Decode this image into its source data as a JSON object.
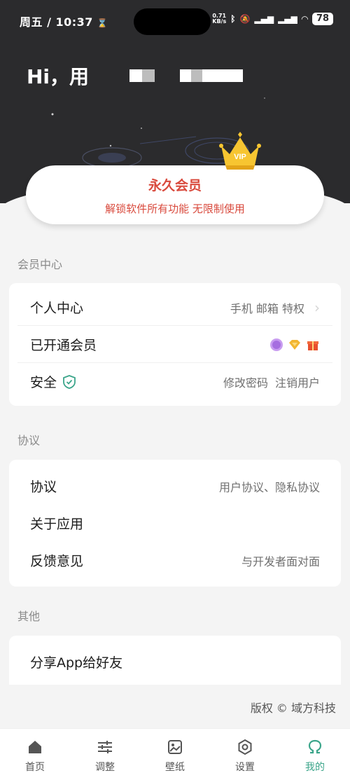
{
  "status_bar": {
    "time": "周五 / 10:37",
    "net_speed_value": "0.71",
    "net_speed_unit": "KB/s",
    "battery": "78"
  },
  "header": {
    "greeting": "Hi，用"
  },
  "membership": {
    "title": "永久会员",
    "subtitle": "解锁软件所有功能 无限制使用",
    "crown_label": "VIP"
  },
  "sections": {
    "member_center": {
      "label": "会员中心",
      "rows": [
        {
          "label": "个人中心",
          "value": "手机 邮箱 特权"
        },
        {
          "label": "已开通会员",
          "value": ""
        },
        {
          "label": "安全",
          "value_a": "修改密码",
          "value_b": "注销用户"
        }
      ]
    },
    "agreement": {
      "label": "协议",
      "rows": [
        {
          "label": "协议",
          "value": "用户协议、隐私协议"
        },
        {
          "label": "关于应用",
          "value": ""
        },
        {
          "label": "反馈意见",
          "value": "与开发者面对面"
        }
      ]
    },
    "other": {
      "label": "其他",
      "rows": [
        {
          "label": "分享App给好友",
          "value": ""
        }
      ]
    }
  },
  "copyright": "版权 © 域方科技",
  "bottom_nav": [
    {
      "label": "首页",
      "icon": "home-icon"
    },
    {
      "label": "调整",
      "icon": "sliders-icon"
    },
    {
      "label": "壁纸",
      "icon": "image-icon"
    },
    {
      "label": "设置",
      "icon": "gear-icon"
    },
    {
      "label": "我的",
      "icon": "omega-icon",
      "active": true
    }
  ],
  "colors": {
    "accent": "#3ba58a",
    "member_red": "#d94a3d",
    "hero_bg": "#2b2b2d",
    "page_bg": "#f4f4f4"
  }
}
